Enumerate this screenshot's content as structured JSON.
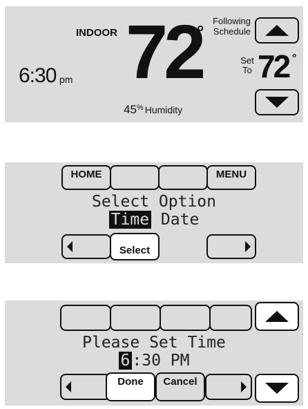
{
  "home_screen": {
    "indoor_label": "INDOOR",
    "indoor_temp": "72",
    "degree": "°",
    "time": "6:30",
    "time_suffix": "pm",
    "humidity_value": "45",
    "humidity_unit": "%",
    "humidity_label": "Humidity",
    "schedule_line1": "Following",
    "schedule_line2": "Schedule",
    "set_line1": "Set",
    "set_line2": "To",
    "set_temp": "72"
  },
  "select_screen": {
    "home_label": "HOME",
    "menu_label": "MENU",
    "prompt": "Select Option",
    "option_selected": "Time",
    "option_other": "Date",
    "select_label": "Select"
  },
  "time_screen": {
    "prompt": "Please Set Time",
    "hour": "6",
    "rest": ":30 PM",
    "done_label": "Done",
    "cancel_label": "Cancel"
  }
}
